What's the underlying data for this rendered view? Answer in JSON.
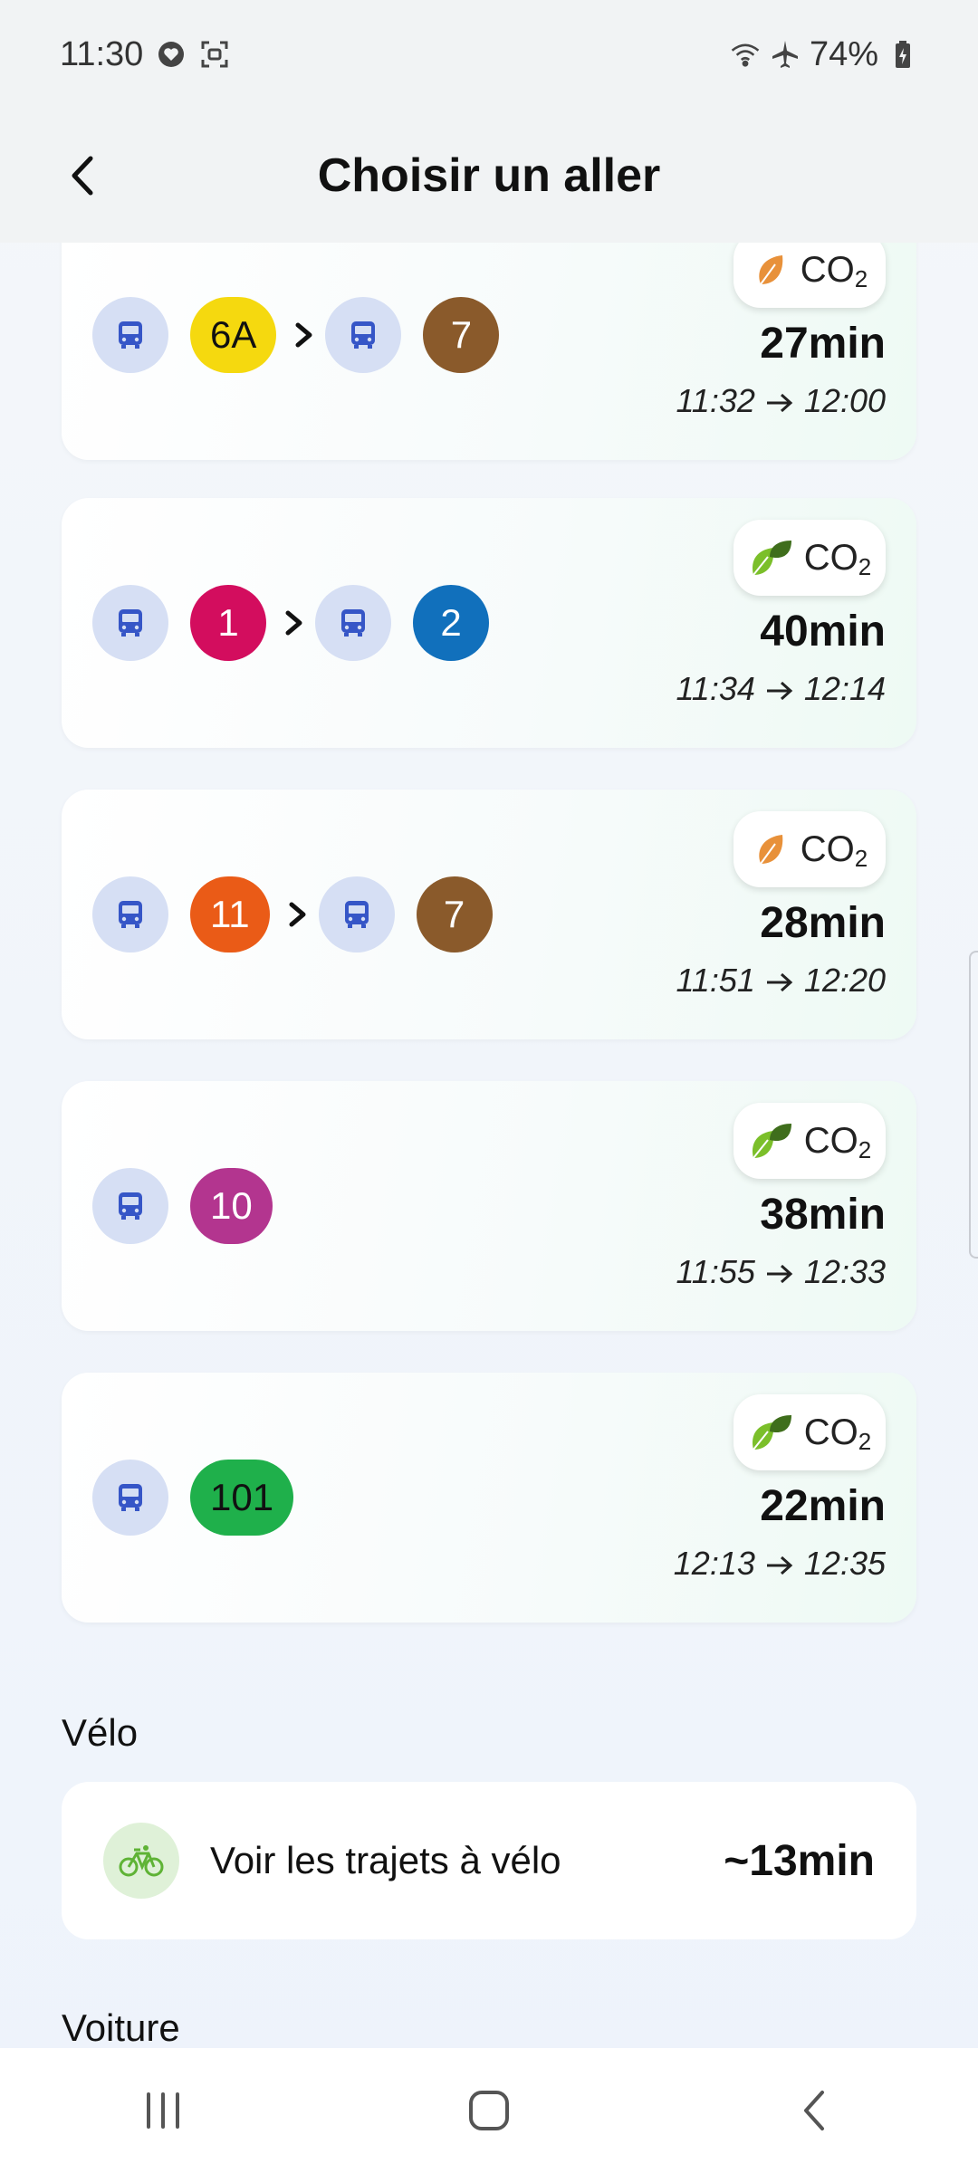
{
  "status_bar": {
    "time": "11:30",
    "battery": "74%"
  },
  "header": {
    "title": "Choisir un aller"
  },
  "colors": {
    "bus_icon": "#3656c7",
    "leaf_orange": "#e8913a",
    "leaf_green": "#7bbf2a"
  },
  "journeys": [
    {
      "legs": [
        {
          "line": "6A",
          "color": "#f5d90f",
          "text_color": "#111111"
        },
        {
          "line": "7",
          "color": "#8a5a2b",
          "text_color": "#ffffff"
        }
      ],
      "co2_level": "orange",
      "co2_label": "CO",
      "co2_sub": "2",
      "duration": "27min",
      "departure": "11:32",
      "arrival": "12:00"
    },
    {
      "legs": [
        {
          "line": "1",
          "color": "#d30d5e",
          "text_color": "#ffffff"
        },
        {
          "line": "2",
          "color": "#1170bc",
          "text_color": "#ffffff"
        }
      ],
      "co2_level": "green",
      "co2_label": "CO",
      "co2_sub": "2",
      "duration": "40min",
      "departure": "11:34",
      "arrival": "12:14"
    },
    {
      "legs": [
        {
          "line": "11",
          "color": "#ea5b17",
          "text_color": "#ffffff"
        },
        {
          "line": "7",
          "color": "#8a5a2b",
          "text_color": "#ffffff"
        }
      ],
      "co2_level": "orange",
      "co2_label": "CO",
      "co2_sub": "2",
      "duration": "28min",
      "departure": "11:51",
      "arrival": "12:20"
    },
    {
      "legs": [
        {
          "line": "10",
          "color": "#b3358f",
          "text_color": "#ffffff"
        }
      ],
      "co2_level": "green",
      "co2_label": "CO",
      "co2_sub": "2",
      "duration": "38min",
      "departure": "11:55",
      "arrival": "12:33"
    },
    {
      "legs": [
        {
          "line": "101",
          "color": "#1fb04b",
          "text_color": "#111111"
        }
      ],
      "co2_level": "green",
      "co2_label": "CO",
      "co2_sub": "2",
      "duration": "22min",
      "departure": "12:13",
      "arrival": "12:35"
    }
  ],
  "bike": {
    "section_title": "Vélo",
    "label": "Voir les trajets à vélo",
    "duration": "~13min"
  },
  "car": {
    "section_title": "Voiture"
  },
  "icons": [
    "back-arrow-icon",
    "bus-icon",
    "chevron-right-icon",
    "leaf-icon",
    "bike-icon",
    "recent-apps-icon",
    "home-icon",
    "nav-back-icon"
  ]
}
